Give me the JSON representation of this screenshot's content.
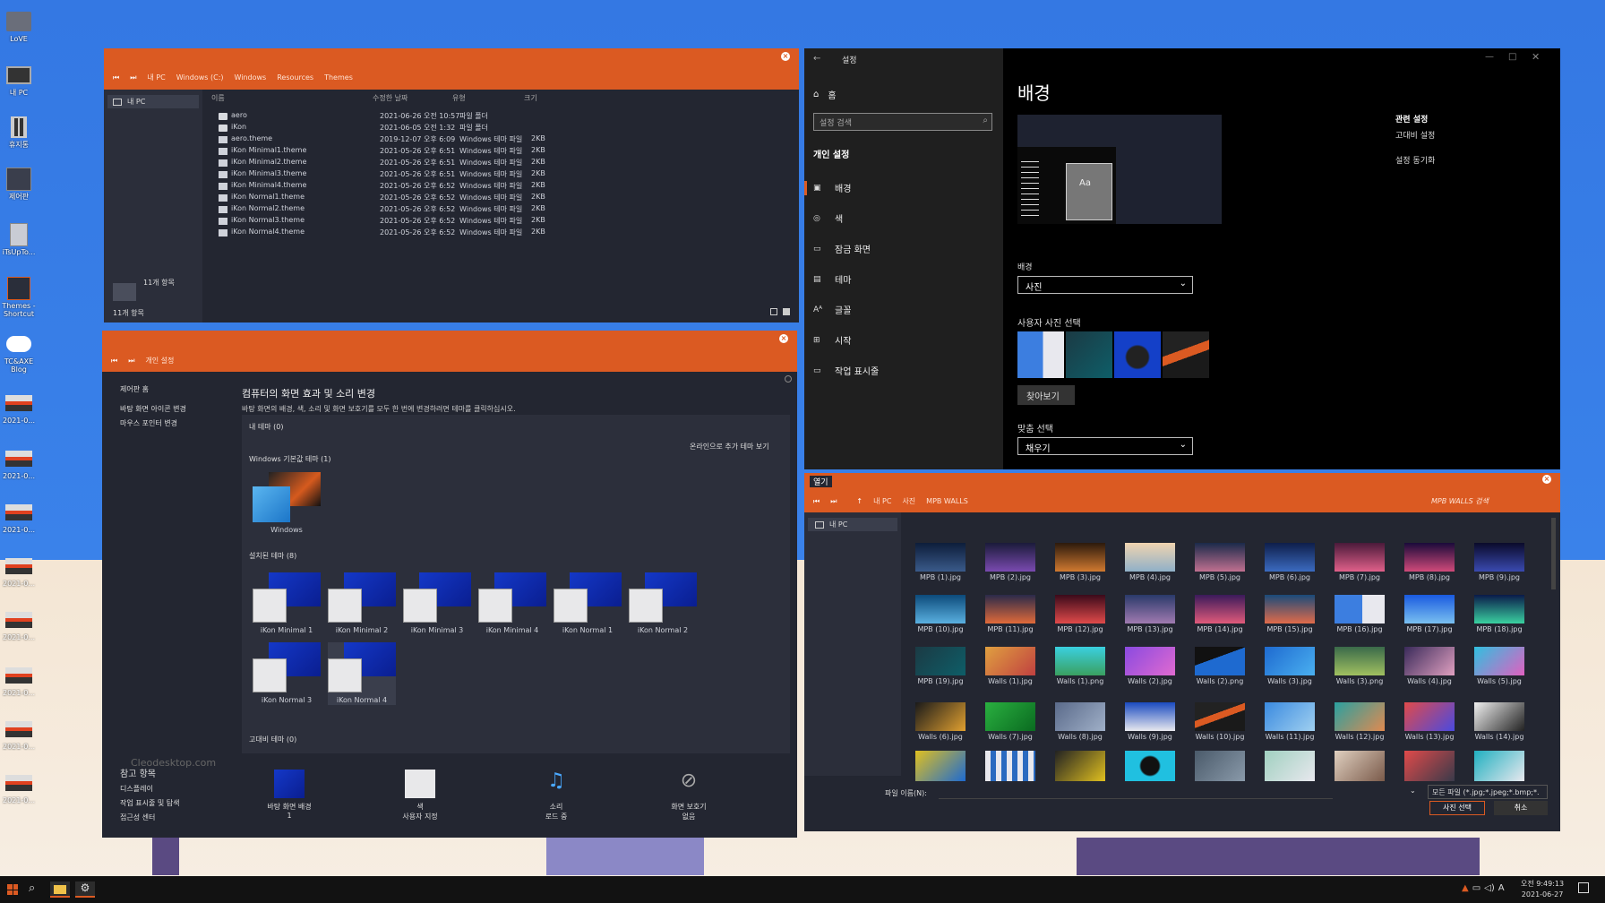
{
  "desktop": {
    "icons": [
      {
        "label": "LoVE",
        "icon": "folder-user-icon"
      },
      {
        "label": "내 PC",
        "icon": "monitor-icon"
      },
      {
        "label": "휴지통",
        "icon": "recycle-bin-icon"
      },
      {
        "label": "제어판",
        "icon": "control-panel-icon"
      },
      {
        "label": "iTsUpTo...",
        "icon": "app-icon"
      },
      {
        "label": "Themes - Shortcut",
        "icon": "shortcut-icon"
      },
      {
        "label": "TC&AXE Blog",
        "icon": "cloud-icon"
      },
      {
        "label": "2021-0...",
        "icon": "image-file-icon"
      },
      {
        "label": "2021-0...",
        "icon": "image-file-icon"
      },
      {
        "label": "2021-0...",
        "icon": "image-file-icon"
      },
      {
        "label": "2021-0...",
        "icon": "image-file-icon"
      },
      {
        "label": "2021-0...",
        "icon": "image-file-icon"
      },
      {
        "label": "2021-0...",
        "icon": "image-file-icon"
      },
      {
        "label": "2021-0...",
        "icon": "image-file-icon"
      },
      {
        "label": "2021-0...",
        "icon": "image-file-icon"
      }
    ]
  },
  "explorer": {
    "breadcrumb": [
      "내 PC",
      "Windows (C:)",
      "Windows",
      "Resources",
      "Themes"
    ],
    "sidebar_item": "내 PC",
    "columns": [
      "이름",
      "수정한 날짜",
      "유형",
      "크기"
    ],
    "files": [
      {
        "name": "aero",
        "date": "2021-06-26 오전 10:57",
        "type": "파일 폴더",
        "size": "",
        "folder": true
      },
      {
        "name": "iKon",
        "date": "2021-06-05 오전 1:32",
        "type": "파일 폴더",
        "size": "",
        "folder": true
      },
      {
        "name": "aero.theme",
        "date": "2019-12-07 오후 6:09",
        "type": "Windows 테마 파일",
        "size": "2KB"
      },
      {
        "name": "iKon Minimal1.theme",
        "date": "2021-05-26 오후 6:51",
        "type": "Windows 테마 파일",
        "size": "2KB"
      },
      {
        "name": "iKon Minimal2.theme",
        "date": "2021-05-26 오후 6:51",
        "type": "Windows 테마 파일",
        "size": "2KB"
      },
      {
        "name": "iKon Minimal3.theme",
        "date": "2021-05-26 오후 6:51",
        "type": "Windows 테마 파일",
        "size": "2KB"
      },
      {
        "name": "iKon Minimal4.theme",
        "date": "2021-05-26 오후 6:52",
        "type": "Windows 테마 파일",
        "size": "2KB"
      },
      {
        "name": "iKon Normal1.theme",
        "date": "2021-05-26 오후 6:52",
        "type": "Windows 테마 파일",
        "size": "2KB"
      },
      {
        "name": "iKon Normal2.theme",
        "date": "2021-05-26 오후 6:52",
        "type": "Windows 테마 파일",
        "size": "2KB"
      },
      {
        "name": "iKon Normal3.theme",
        "date": "2021-05-26 오후 6:52",
        "type": "Windows 테마 파일",
        "size": "2KB"
      },
      {
        "name": "iKon Normal4.theme",
        "date": "2021-05-26 오후 6:52",
        "type": "Windows 테마 파일",
        "size": "2KB"
      }
    ],
    "item_count_detail": "11개 항목",
    "status": "11개 항목"
  },
  "personalize": {
    "breadcrumb": "개인 설정",
    "nav": [
      "제어판 홈",
      "바탕 화면 아이콘 변경",
      "마우스 포인터 변경"
    ],
    "heading": "컴퓨터의 화면 효과 및 소리 변경",
    "subheading": "바탕 화면의 배경, 색, 소리 및 화면 보호기를 모두 한 번에 변경하려면 테마를 클릭하십시오.",
    "my_themes": "내 테마 (0)",
    "online_link": "온라인으로 추가 테마 보기",
    "default_themes": "Windows 기본값 테마 (1)",
    "default_theme_name": "Windows",
    "installed": "설치된 테마 (8)",
    "themes": [
      "iKon Minimal 1",
      "iKon Minimal 2",
      "iKon Minimal 3",
      "iKon Minimal 4",
      "iKon Normal 1",
      "iKon Normal 2",
      "iKon Normal 3",
      "iKon Normal 4"
    ],
    "high_contrast": "고대비 테마 (0)",
    "watermark": "Cleodesktop.com",
    "see_also": "참고 항목",
    "see_also_links": [
      "디스플레이",
      "작업 표시줄 및 탐색",
      "접근성 센터"
    ],
    "bottom": [
      {
        "line1": "바탕 화면 배경",
        "line2": "1",
        "icon": "wallpaper-icon"
      },
      {
        "line1": "색",
        "line2": "사용자 지정",
        "icon": "color-icon"
      },
      {
        "line1": "소리",
        "line2": "로드 중",
        "icon": "sound-icon"
      },
      {
        "line1": "화면 보호기",
        "line2": "없음",
        "icon": "screensaver-icon"
      }
    ]
  },
  "settings": {
    "title": "설정",
    "home": "홈",
    "search_placeholder": "설정 검색",
    "section": "개인 설정",
    "nav": [
      {
        "label": "배경",
        "icon": "image-icon"
      },
      {
        "label": "색",
        "icon": "palette-icon"
      },
      {
        "label": "잠금 화면",
        "icon": "lock-screen-icon"
      },
      {
        "label": "테마",
        "icon": "theme-icon"
      },
      {
        "label": "글꼴",
        "icon": "font-icon"
      },
      {
        "label": "시작",
        "icon": "start-icon"
      },
      {
        "label": "작업 표시줄",
        "icon": "taskbar-icon"
      }
    ],
    "page_title": "배경",
    "bg_label": "배경",
    "bg_value": "사진",
    "choose_photo": "사용자 사진 선택",
    "browse": "찾아보기",
    "fit_label": "맞춤 선택",
    "fit_value": "채우기",
    "related_title": "관련 설정",
    "related": [
      "고대비 설정",
      "설정 동기화"
    ],
    "preview_text": "Aa"
  },
  "open_dialog": {
    "title": "열기",
    "breadcrumb": [
      "내 PC",
      "사진",
      "MPB WALLS"
    ],
    "search_placeholder": "MPB WALLS 검색",
    "sidebar_item": "내 PC",
    "files": [
      "MPB (1).jpg",
      "MPB (2).jpg",
      "MPB (3).jpg",
      "MPB (4).jpg",
      "MPB (5).jpg",
      "MPB (6).jpg",
      "MPB (7).jpg",
      "MPB (8).jpg",
      "MPB (9).jpg",
      "MPB (10).jpg",
      "MPB (11).jpg",
      "MPB (12).jpg",
      "MPB (13).jpg",
      "MPB (14).jpg",
      "MPB (15).jpg",
      "MPB (16).jpg",
      "MPB (17).jpg",
      "MPB (18).jpg",
      "MPB (19).jpg",
      "Walls (1).jpg",
      "Walls (1).png",
      "Walls (2).jpg",
      "Walls (2).png",
      "Walls (3).jpg",
      "Walls (3).png",
      "Walls (4).jpg",
      "Walls (5).jpg",
      "Walls (6).jpg",
      "Walls (7).jpg",
      "Walls (8).jpg",
      "Walls (9).jpg",
      "Walls (10).jpg",
      "Walls (11).jpg",
      "Walls (12).jpg",
      "Walls (13).jpg",
      "Walls (14).jpg"
    ],
    "filename_label": "파일 이름(N):",
    "filetype": "모든 파일 (*.jpg;*.jpeg;*.bmp;*.",
    "select": "사진 선택",
    "cancel": "취소"
  },
  "taskbar": {
    "time": "오전 9:49:13",
    "date": "2021-06-27",
    "ime": "A"
  },
  "colors": {
    "accent": "#db5a22",
    "window": "#232631",
    "desktop": "#3478e3"
  }
}
